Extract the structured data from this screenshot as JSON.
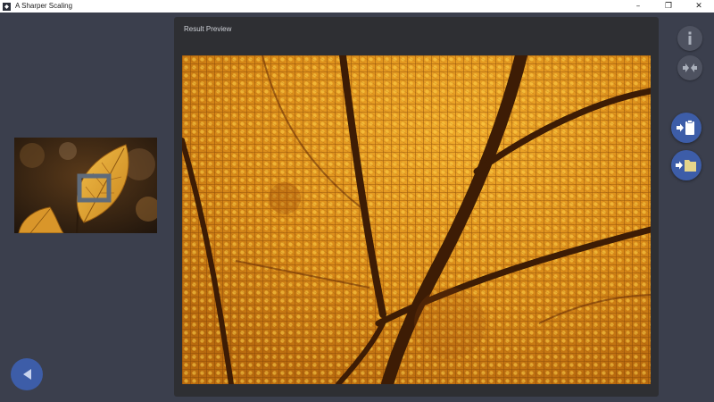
{
  "window": {
    "title": "A Sharper Scaling",
    "controls": [
      "–",
      "❐",
      "✕"
    ]
  },
  "panel": {
    "title": "Result Preview"
  },
  "toolbar": {
    "icons": [
      "info-icon",
      "compare-icon",
      "copy-to-clipboard-icon",
      "save-to-folder-icon",
      "back-arrow-icon"
    ]
  },
  "colors": {
    "background": "#3b3f4d",
    "panel": "#2e2f33",
    "accent": "#3d5da8",
    "leaf": "#e3a023"
  }
}
